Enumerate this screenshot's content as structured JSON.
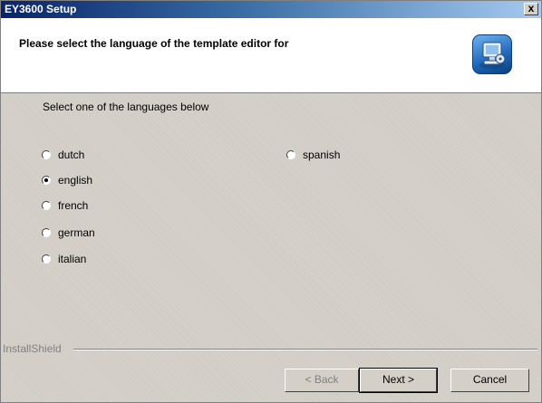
{
  "window": {
    "title": "EY3600 Setup",
    "close_label": "x"
  },
  "header": {
    "heading": "Please select the language of the template editor for",
    "icon": "computer-installer-icon"
  },
  "main": {
    "instruction": "Select one of the languages below",
    "languages": [
      {
        "label": "dutch",
        "checked": false
      },
      {
        "label": "english",
        "checked": true
      },
      {
        "label": "french",
        "checked": false
      },
      {
        "label": "german",
        "checked": false
      },
      {
        "label": "italian",
        "checked": false
      },
      {
        "label": "spanish",
        "checked": false
      }
    ]
  },
  "footer": {
    "brand": "InstallShield",
    "back_label": "< Back",
    "next_label": "Next >",
    "cancel_label": "Cancel"
  }
}
